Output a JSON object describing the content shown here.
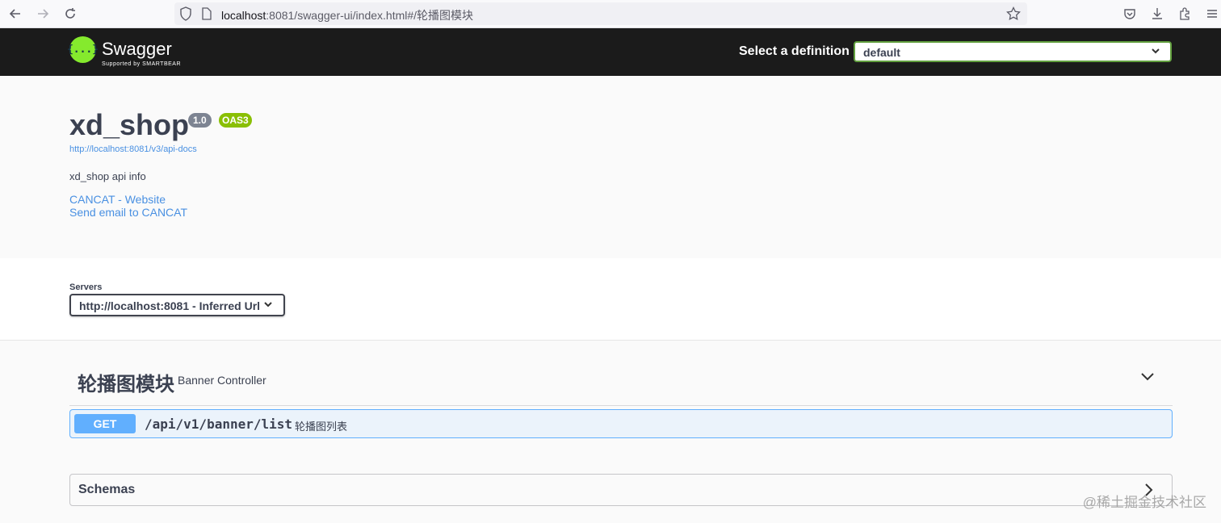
{
  "browser": {
    "url_host": "localhost",
    "url_rest": ":8081/swagger-ui/index.html#/轮播图模块"
  },
  "topbar": {
    "logo_glyph": "{...}",
    "logo_title": "Swagger",
    "logo_sub": "Supported by SMARTBEAR",
    "definition_label": "Select a definition",
    "definition_value": "default"
  },
  "info": {
    "title": "xd_shop",
    "version": "1.0",
    "oas": "OAS3",
    "url": "http://localhost:8081/v3/api-docs",
    "description": "xd_shop api info",
    "contact_website": "CANCAT - Website",
    "contact_email": "Send email to CANCAT"
  },
  "servers": {
    "label": "Servers",
    "selected": "http://localhost:8081 - Inferred Url"
  },
  "tag": {
    "name": "轮播图模块",
    "description": "Banner Controller",
    "operations": [
      {
        "method": "GET",
        "path": "/api/v1/banner/list",
        "summary": "轮播图列表"
      }
    ]
  },
  "schemas": {
    "title": "Schemas"
  },
  "watermark": "@稀土掘金技术社区",
  "colors": {
    "topbar": "#1b1b1b",
    "get_method": "#61affe",
    "oas_badge": "#89bf04",
    "version_badge": "#7d8492",
    "link": "#4990e2"
  }
}
